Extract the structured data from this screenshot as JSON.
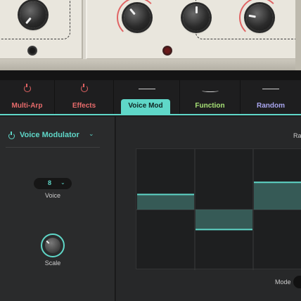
{
  "tabs": {
    "multi_arp": "Multi-Arp",
    "effects": "Effects",
    "voice_mod": "Voice Mod",
    "function": "Function",
    "random": "Random",
    "selected": "Voice Mod"
  },
  "module": {
    "name": "Voice Modulator",
    "voice": {
      "label": "Voice",
      "value": "8"
    },
    "scale": {
      "label": "Scale"
    }
  },
  "editor": {
    "rate_label": "Ra",
    "mode_label": "Mode",
    "step_levels": [
      0.25,
      -0.33,
      0.45
    ],
    "colors": {
      "accent": "#5fd7c8",
      "fill": "#3f6f68",
      "grid": "#3a3b3c"
    }
  },
  "icons": {
    "tab_power": "power-icon",
    "module_power": "power-icon",
    "dropdown": "chevron-down-icon"
  }
}
